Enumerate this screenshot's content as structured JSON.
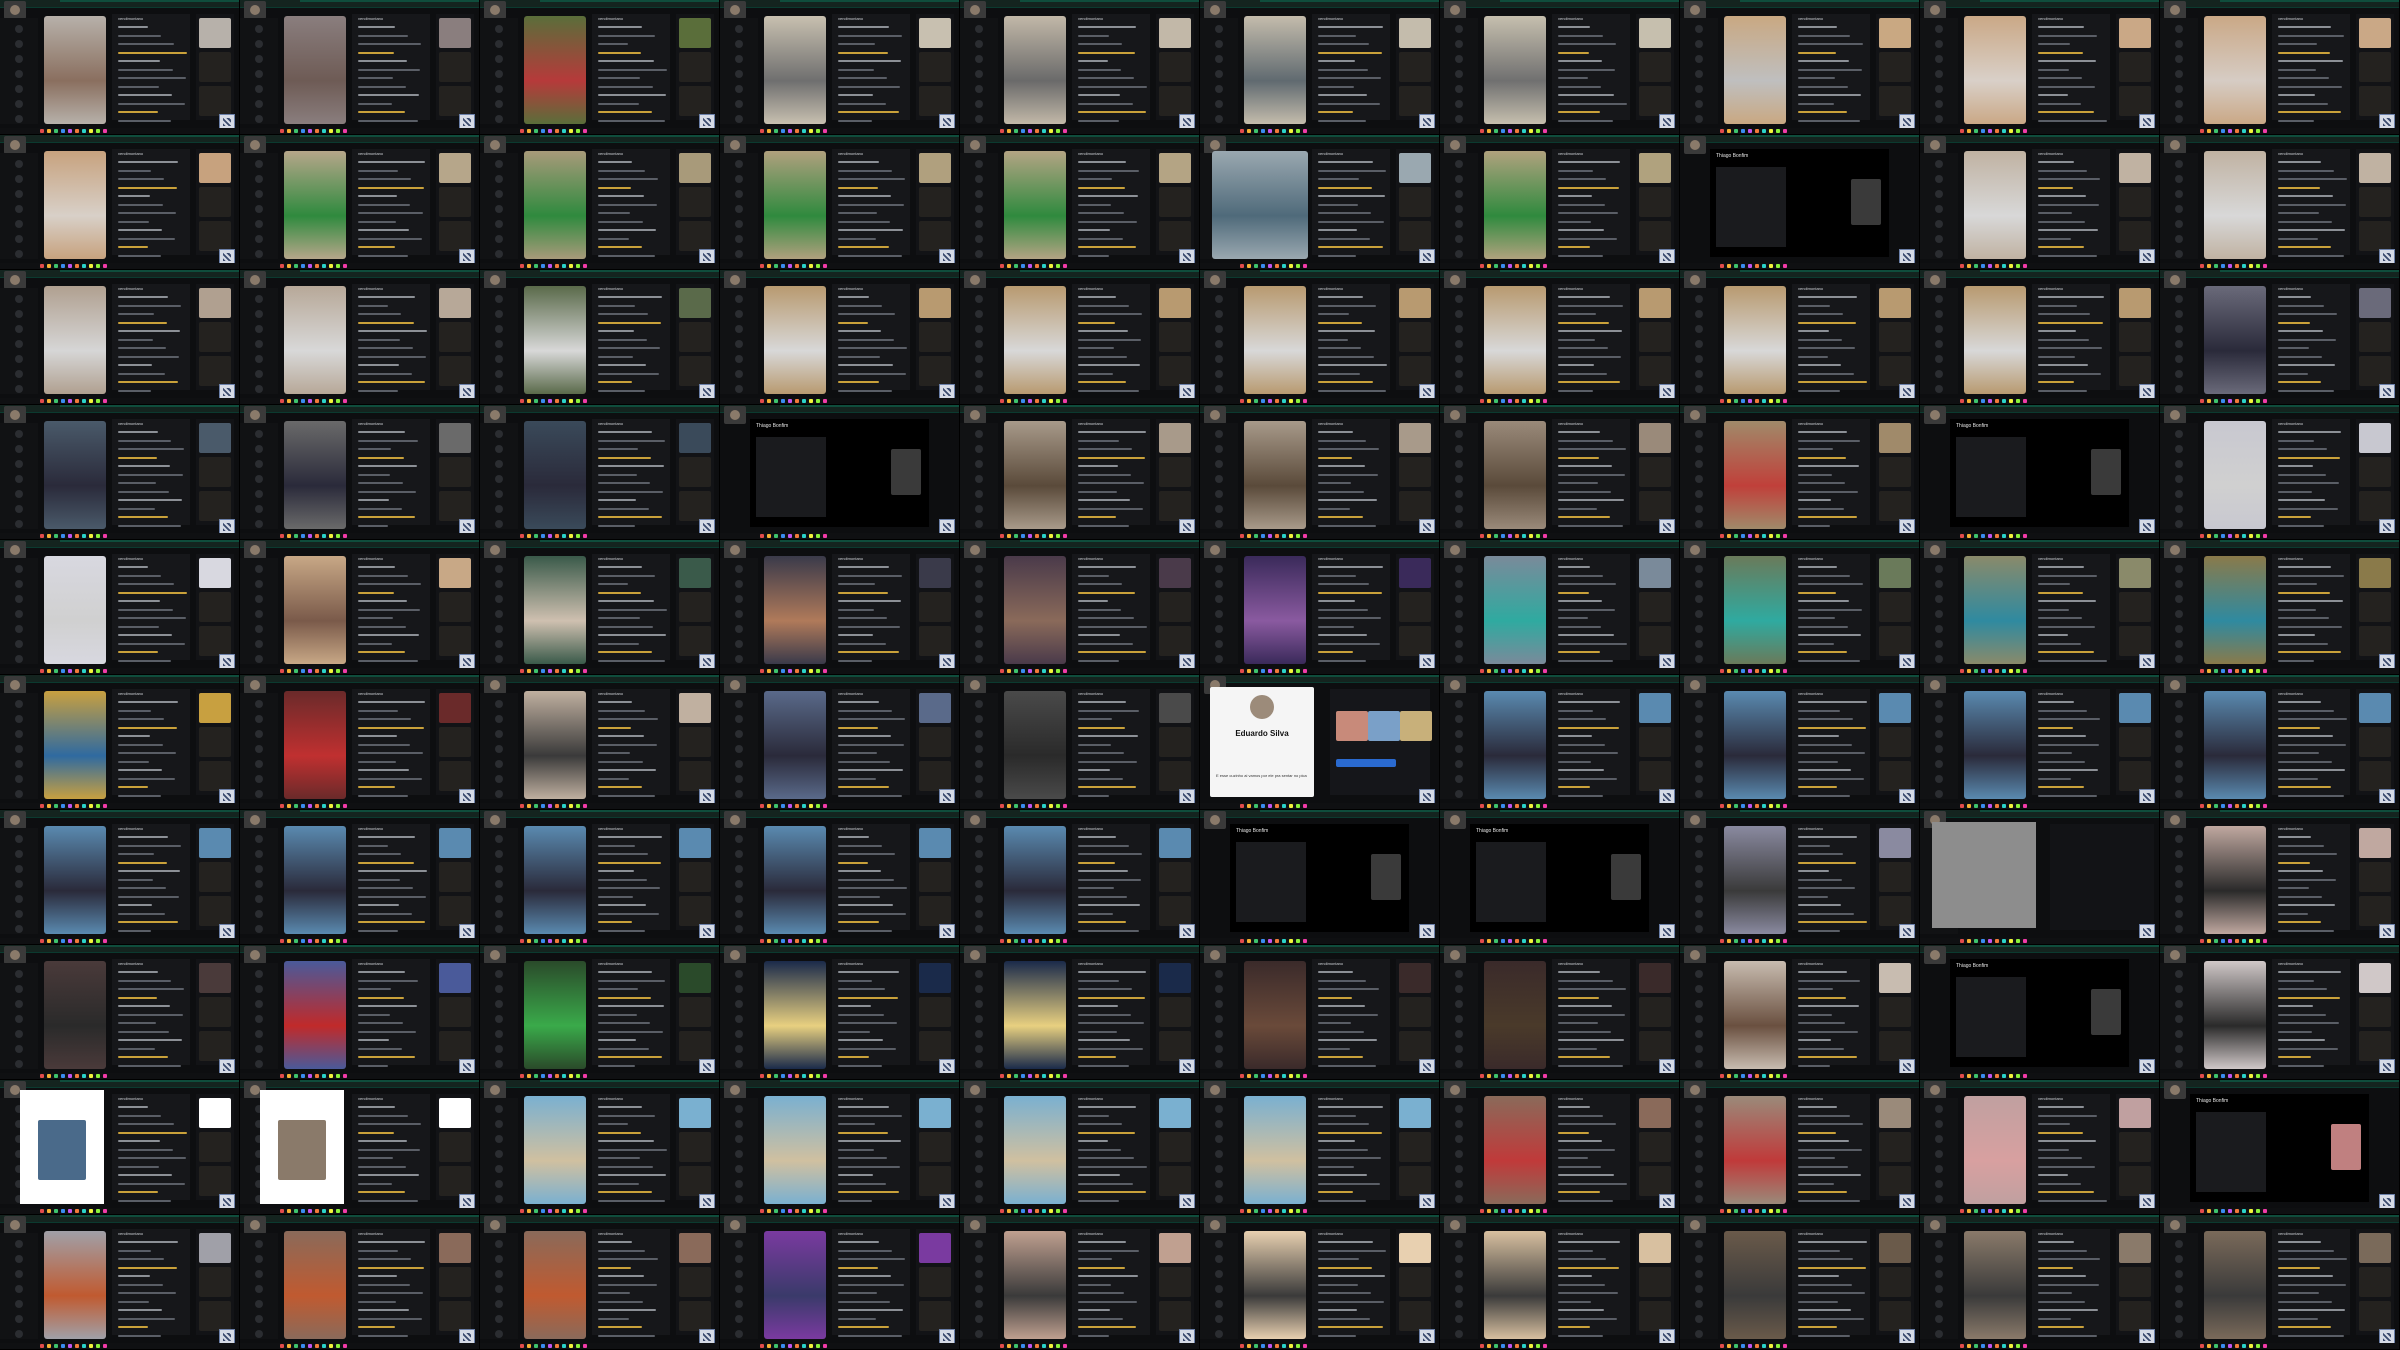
{
  "screen": {
    "layout": "contact-sheet",
    "rows": 10,
    "cols": 10
  },
  "special_texts": {
    "profile_name": "Eduardo Silva",
    "profile_caption": "E esse cuzinho ai vamos por ele pra sentar no pica"
  },
  "tiles": [
    {
      "kind": "live",
      "v": "#b7b1aa",
      "f": "#8a6f5f",
      "user": "vendimontano"
    },
    {
      "kind": "live",
      "v": "#8a7e7e",
      "f": "#6e5b55",
      "user": "vendimontano"
    },
    {
      "kind": "live",
      "v": "#5a6e3a",
      "f": "#b63a3a",
      "user": "vendimontano"
    },
    {
      "kind": "live",
      "v": "#c8c0b0",
      "f": "#6f6f6f",
      "user": "vendimontano"
    },
    {
      "kind": "live",
      "v": "#c2b8a8",
      "f": "#6a6a6a",
      "user": "vendimontano"
    },
    {
      "kind": "live",
      "v": "#c4bcac",
      "f": "#606a70",
      "user": "vendimontano"
    },
    {
      "kind": "live",
      "v": "#c6bfae",
      "f": "#707070",
      "user": "vendimontano"
    },
    {
      "kind": "live",
      "v": "#c9a882",
      "f": "#bfbfbf",
      "user": "vendimontano"
    },
    {
      "kind": "live",
      "v": "#caa886",
      "f": "#d9d0c8",
      "user": "vendimontano"
    },
    {
      "kind": "live",
      "v": "#caa886",
      "f": "#d6ccc4",
      "user": "vendimontano"
    },
    {
      "kind": "live",
      "v": "#c7a27e",
      "f": "#d8d0c8",
      "user": "vendimontano"
    },
    {
      "kind": "live",
      "v": "#b6a68a",
      "f": "#2f8a3e",
      "user": "vendimontano"
    },
    {
      "kind": "live",
      "v": "#a89a7a",
      "f": "#2f8a3e",
      "user": "vendimontano"
    },
    {
      "kind": "live",
      "v": "#b0a07e",
      "f": "#2f8a3e",
      "user": "vendimontano"
    },
    {
      "kind": "live",
      "v": "#b4a484",
      "f": "#2f8a3e",
      "user": "vendimontano"
    },
    {
      "kind": "wide",
      "v": "#9aa8b0",
      "f": "#4f6a7a",
      "user": "vendimontano"
    },
    {
      "kind": "live",
      "v": "#b0a27e",
      "f": "#2f8a3e",
      "user": "vendimontano"
    },
    {
      "kind": "shared",
      "v": "#000000",
      "f": "#3a3a3a",
      "user": "Thiago Bonfim"
    },
    {
      "kind": "live",
      "v": "#c0b2a2",
      "f": "#d8d8d8",
      "user": "vendimontano"
    },
    {
      "kind": "live",
      "v": "#c0b2a2",
      "f": "#d8d8d8",
      "user": "vendimontano"
    },
    {
      "kind": "live",
      "v": "#b0a090",
      "f": "#d6d6d6",
      "user": "vendimontano"
    },
    {
      "kind": "live",
      "v": "#b7a898",
      "f": "#d8d8d8",
      "user": "vendimontano"
    },
    {
      "kind": "live",
      "v": "#5a6a4a",
      "f": "#d8d8d8",
      "user": "vendimontano"
    },
    {
      "kind": "live",
      "v": "#b89a70",
      "f": "#d8d8d8",
      "user": "vendimontano"
    },
    {
      "kind": "live",
      "v": "#b89a70",
      "f": "#d8d8d8",
      "user": "vendimontano"
    },
    {
      "kind": "live",
      "v": "#b89a70",
      "f": "#d8d8d8",
      "user": "vendimontano"
    },
    {
      "kind": "live",
      "v": "#b89a70",
      "f": "#d8d8d8",
      "user": "vendimontano"
    },
    {
      "kind": "live",
      "v": "#b89a70",
      "f": "#d8d8d8",
      "user": "vendimontano"
    },
    {
      "kind": "live",
      "v": "#b89a70",
      "f": "#d8d8d8",
      "user": "vendimontano"
    },
    {
      "kind": "live",
      "v": "#6a6a7a",
      "f": "#2a2a3a",
      "user": "vendimontano"
    },
    {
      "kind": "live",
      "v": "#4a5a6a",
      "f": "#2a2a3a",
      "user": "vendimontano"
    },
    {
      "kind": "live",
      "v": "#6a6a6a",
      "f": "#2a2a3a",
      "user": "vendimontano"
    },
    {
      "kind": "live",
      "v": "#3a4a5a",
      "f": "#2a2a3a",
      "user": "vendimontano"
    },
    {
      "kind": "shared",
      "v": "#000000",
      "f": "#3a3a3a",
      "user": "Thiago Bonfim"
    },
    {
      "kind": "live",
      "v": "#a89a8a",
      "f": "#5a4a3a",
      "user": "vendimontano"
    },
    {
      "kind": "live",
      "v": "#a89a8a",
      "f": "#5a4a3a",
      "user": "vendimontano"
    },
    {
      "kind": "live",
      "v": "#9a8a7a",
      "f": "#5a4a3a",
      "user": "vendimontano"
    },
    {
      "kind": "live",
      "v": "#a08a6a",
      "f": "#c0403a",
      "user": "vendimontano"
    },
    {
      "kind": "shared",
      "v": "#000000",
      "f": "#3a3a3a",
      "user": "Thiago Bonfim"
    },
    {
      "kind": "live",
      "v": "#c8c8d0",
      "f": "#d0d0d0",
      "user": "vendimontano"
    },
    {
      "kind": "live",
      "v": "#d8d8e0",
      "f": "#d0d0d0",
      "user": "vendimontano"
    },
    {
      "kind": "live",
      "v": "#c8a886",
      "f": "#7a5a4a",
      "user": "vendimontano"
    },
    {
      "kind": "live",
      "v": "#3a5a4a",
      "f": "#cfc0b0",
      "user": "vendimontano"
    },
    {
      "kind": "live",
      "v": "#3a3a4a",
      "f": "#b07a5a",
      "user": "vendimontano"
    },
    {
      "kind": "live",
      "v": "#4a3a4a",
      "f": "#8a6a5a",
      "user": "vendimontano"
    },
    {
      "kind": "live",
      "v": "#3a2a5a",
      "f": "#8a5aa0",
      "user": "vendimontano"
    },
    {
      "kind": "live",
      "v": "#7a8a9a",
      "f": "#2faaa0",
      "user": "vendimontano"
    },
    {
      "kind": "live",
      "v": "#6a7a5a",
      "f": "#2faaa0",
      "user": "vendimontano"
    },
    {
      "kind": "live",
      "v": "#8a8a6a",
      "f": "#2f8aa0",
      "user": "vendimontano"
    },
    {
      "kind": "live",
      "v": "#8a7a4a",
      "f": "#2f8aa0",
      "user": "vendimontano"
    },
    {
      "kind": "live",
      "v": "#c8a040",
      "f": "#2f6aa0",
      "user": "vendimontano"
    },
    {
      "kind": "live",
      "v": "#6a2a2a",
      "f": "#c03030",
      "user": "vendimontano"
    },
    {
      "kind": "live",
      "v": "#c0b0a0",
      "f": "#3a3a3a",
      "user": "vendimontano"
    },
    {
      "kind": "live",
      "v": "#5a6a8a",
      "f": "#2a2a3a",
      "user": "vendimontano"
    },
    {
      "kind": "live",
      "v": "#4a4a4a",
      "f": "#2a2a2a",
      "user": "vendimontano"
    },
    {
      "kind": "profile",
      "v": "#f5f5f5",
      "f": "#2a6ad0",
      "user": "vendimontano"
    },
    {
      "kind": "live",
      "v": "#5a8ab0",
      "f": "#2a2a3a",
      "user": "vendimontano"
    },
    {
      "kind": "live",
      "v": "#5a8ab0",
      "f": "#2a2a3a",
      "user": "vendimontano"
    },
    {
      "kind": "live",
      "v": "#5a8ab0",
      "f": "#2a2a3a",
      "user": "vendimontano"
    },
    {
      "kind": "live",
      "v": "#5a8ab0",
      "f": "#2a2a3a",
      "user": "vendimontano"
    },
    {
      "kind": "live",
      "v": "#5a8ab0",
      "f": "#2a2a3a",
      "user": "vendimontano"
    },
    {
      "kind": "live",
      "v": "#5a8ab0",
      "f": "#2a2a3a",
      "user": "vendimontano"
    },
    {
      "kind": "live",
      "v": "#5a8ab0",
      "f": "#2a2a3a",
      "user": "vendimontano"
    },
    {
      "kind": "live",
      "v": "#5a8ab0",
      "f": "#2a2a3a",
      "user": "vendimontano"
    },
    {
      "kind": "live",
      "v": "#5a8ab0",
      "f": "#2a2a3a",
      "user": "vendimontano"
    },
    {
      "kind": "shared",
      "v": "#000000",
      "f": "#3a3a3a",
      "user": "Thiago Bonfim"
    },
    {
      "kind": "shared",
      "v": "#000000",
      "f": "#3a3a3a",
      "user": "Thiago Bonfim"
    },
    {
      "kind": "live",
      "v": "#8a8aa0",
      "f": "#3a3a3a",
      "user": "vendimontano"
    },
    {
      "kind": "grey",
      "v": "#8d8d8d",
      "f": "#2a2a2a",
      "user": "vendimontano"
    },
    {
      "kind": "live",
      "v": "#c0a8a0",
      "f": "#2a2a2a",
      "user": "vendimontano"
    },
    {
      "kind": "live",
      "v": "#4a3a3a",
      "f": "#2a2a2a",
      "user": "vendimontano"
    },
    {
      "kind": "live",
      "v": "#4a5a9a",
      "f": "#c02a2a",
      "user": "vendimontano"
    },
    {
      "kind": "live",
      "v": "#2a4a2a",
      "f": "#3aaa4a",
      "user": "vendimontano"
    },
    {
      "kind": "live",
      "v": "#1a2a4a",
      "f": "#e8d080",
      "user": "vendimontano"
    },
    {
      "kind": "live",
      "v": "#1a2a4a",
      "f": "#e8d080",
      "user": "vendimontano"
    },
    {
      "kind": "live",
      "v": "#3a2a2a",
      "f": "#6a4a3a",
      "user": "vendimontano"
    },
    {
      "kind": "live",
      "v": "#3a2a2a",
      "f": "#4a3a2a",
      "user": "vendimontano"
    },
    {
      "kind": "live",
      "v": "#c8bcb0",
      "f": "#6a5040",
      "user": "vendimontano"
    },
    {
      "kind": "shared",
      "v": "#000000",
      "f": "#3a3a3a",
      "user": "Thiago Bonfim"
    },
    {
      "kind": "live",
      "v": "#d0c8c8",
      "f": "#2a2a2a",
      "user": "vendimontano"
    },
    {
      "kind": "poster",
      "v": "#ffffff",
      "f": "#4a6a8a",
      "user": "vendimontano"
    },
    {
      "kind": "poster",
      "v": "#ffffff",
      "f": "#8a7a6a",
      "user": "vendimontano"
    },
    {
      "kind": "live",
      "v": "#7ab0d0",
      "f": "#d0c0a0",
      "user": "vendimontano"
    },
    {
      "kind": "live",
      "v": "#7ab0d0",
      "f": "#d0c0a0",
      "user": "vendimontano"
    },
    {
      "kind": "live",
      "v": "#7ab0d0",
      "f": "#d0c0a0",
      "user": "vendimontano"
    },
    {
      "kind": "live",
      "v": "#7ab0d0",
      "f": "#d0c0a0",
      "user": "vendimontano"
    },
    {
      "kind": "live",
      "v": "#8a6a5a",
      "f": "#c03a3a",
      "user": "vendimontano"
    },
    {
      "kind": "live",
      "v": "#9a8a7a",
      "f": "#c03a3a",
      "user": "vendimontano"
    },
    {
      "kind": "live",
      "v": "#c0a0a0",
      "f": "#d8a0a0",
      "user": "vendimontano"
    },
    {
      "kind": "shared",
      "v": "#000000",
      "f": "#c08080",
      "user": "Thiago Bonfim"
    },
    {
      "kind": "live",
      "v": "#a0a0a8",
      "f": "#c05a30",
      "user": "vendimontano"
    },
    {
      "kind": "live",
      "v": "#8a6a5a",
      "f": "#c05a30",
      "user": "vendimontano"
    },
    {
      "kind": "live",
      "v": "#8a6a5a",
      "f": "#c05a30",
      "user": "vendimontano"
    },
    {
      "kind": "live",
      "v": "#7a3aa0",
      "f": "#3a3a6a",
      "user": "vendimontano"
    },
    {
      "kind": "live",
      "v": "#c0a090",
      "f": "#3a3a3a",
      "user": "vendimontano"
    },
    {
      "kind": "live",
      "v": "#e8d0b0",
      "f": "#3a3a3a",
      "user": "vendimontano"
    },
    {
      "kind": "live",
      "v": "#d8c0a0",
      "f": "#3a3a3a",
      "user": "vendimontano"
    },
    {
      "kind": "live",
      "v": "#6a5a4a",
      "f": "#3a3a3a",
      "user": "vendimontano"
    },
    {
      "kind": "live",
      "v": "#8a7a6a",
      "f": "#3a3a3a",
      "user": "vendimontano"
    },
    {
      "kind": "live",
      "v": "#7a6a5a",
      "f": "#3a3a3a",
      "user": "vendimontano"
    }
  ]
}
